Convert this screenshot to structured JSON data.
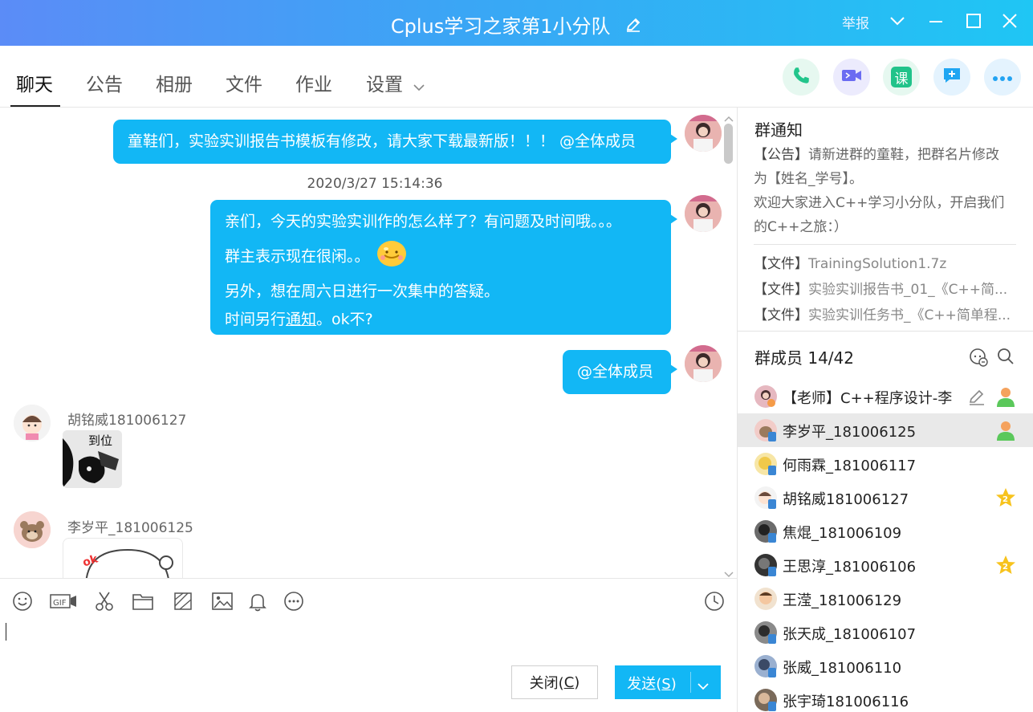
{
  "window": {
    "title": "Cplus学习之家第1小分队",
    "report_label": "举报"
  },
  "tabs": [
    {
      "label": "聊天"
    },
    {
      "label": "公告"
    },
    {
      "label": "相册"
    },
    {
      "label": "文件"
    },
    {
      "label": "作业"
    },
    {
      "label": "设置"
    }
  ],
  "actions": [
    {
      "icon": "phone-icon",
      "color": "#22c58b"
    },
    {
      "icon": "video-icon",
      "color": "#6b6cf2"
    },
    {
      "icon": "class-icon",
      "label": "课",
      "color": "#21c38a"
    },
    {
      "icon": "message-plus-icon",
      "color": "#1fa6f2"
    },
    {
      "icon": "more-icon",
      "color": "#22a3f2"
    }
  ],
  "chat": {
    "messages": [
      {
        "text": "童鞋们，实验实训报告书模板有修改，请大家下载最新版！！！ @全体成员"
      },
      {
        "timestamp": "2020/3/27 15:14:36"
      },
      {
        "lines": [
          "亲们，今天的实验实训作的怎么样了？有问题及时间哦。。。",
          "群主表示现在很闲。。",
          "另外，想在周六日进行一次集中的答疑。",
          "时间另行",
          "通知",
          "。ok不?"
        ]
      },
      {
        "text": "@全体成员"
      },
      {
        "sender": "胡铭威181006127",
        "sticker_text": "到位"
      },
      {
        "sender": "李岁平_181006125",
        "sticker_text": "ok"
      }
    ]
  },
  "composer": {
    "tools": [
      "emoji-icon",
      "gif-icon",
      "scissors-icon",
      "folder-icon",
      "screenshot-icon",
      "image-icon",
      "bell-icon",
      "more-circle-icon",
      "history-clock-icon"
    ],
    "close_label": "关闭(",
    "close_key": "C",
    "close_end": ")",
    "send_label": "发送(",
    "send_key": "S",
    "send_end": ")"
  },
  "notice": {
    "title": "群通知",
    "tag": "【公告】",
    "line1": "请新进群的童鞋，把群名片修改",
    "line2": "为【姓名_学号】。",
    "line3": "欢迎大家进入C++学习小分队，开启我们",
    "line4": "的C++之旅：）",
    "files": [
      {
        "tag": "【文件】",
        "name": "TrainingSolution1.7z"
      },
      {
        "tag": "【文件】",
        "name": "实验实训报告书_01_《C++简..."
      },
      {
        "tag": "【文件】",
        "name": "实验实训任务书_《C++简单程..."
      }
    ]
  },
  "members": {
    "title": "群成员 14/42",
    "list": [
      {
        "name": "【老师】C++程序设计-李",
        "badge": "admin"
      },
      {
        "name": "李岁平_181006125",
        "badge": "admin",
        "selected": true
      },
      {
        "name": "何雨霖_181006117"
      },
      {
        "name": "胡铭威181006127",
        "badge": "star"
      },
      {
        "name": "焦焜_181006109"
      },
      {
        "name": "王思淳_181006106",
        "badge": "star"
      },
      {
        "name": "王滢_181006129"
      },
      {
        "name": "张天成_181006107"
      },
      {
        "name": "张威_181006110"
      },
      {
        "name": "张宇琦181006116"
      }
    ]
  },
  "colors": {
    "accent": "#12b7f5",
    "title_gradient_start": "#5b8cf7",
    "title_gradient_end": "#1fc6f4"
  }
}
